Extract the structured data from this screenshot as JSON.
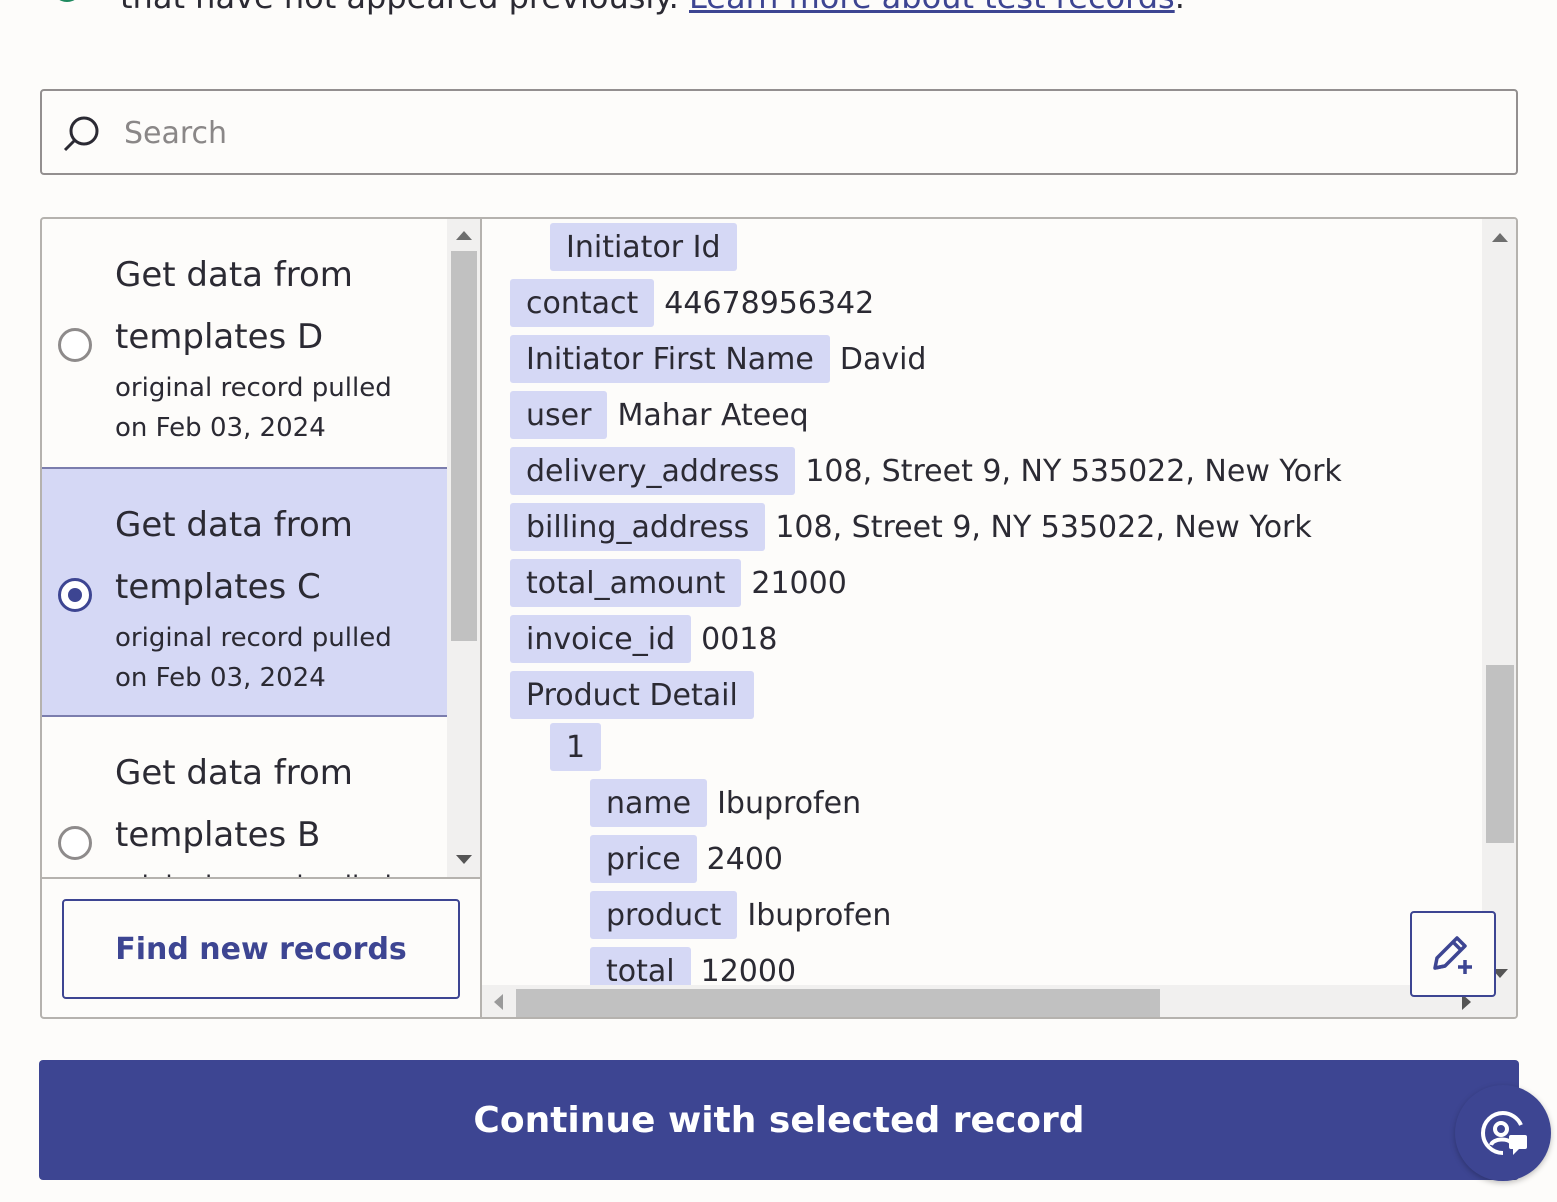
{
  "intro": {
    "text": "that have not appeared previously.",
    "link": "Learn more about test records",
    "trailing": "."
  },
  "search": {
    "placeholder": "Search"
  },
  "records": [
    {
      "title_line1": "Get data from",
      "title_line2": "templates D",
      "sub_line1": "original record pulled",
      "sub_line2": "on Feb 03, 2024",
      "selected": false
    },
    {
      "title_line1": "Get data from",
      "title_line2": "templates C",
      "sub_line1": "original record pulled",
      "sub_line2": "on Feb 03, 2024",
      "selected": true
    },
    {
      "title_line1": "Get data from",
      "title_line2": "templates B",
      "sub_line1": "original record pulled",
      "sub_line2": "",
      "selected": false
    }
  ],
  "find_button": "Find new records",
  "fields": [
    {
      "key": "Initiator Id",
      "value": ""
    },
    {
      "key": "contact",
      "value": "44678956342"
    },
    {
      "key": "Initiator First Name",
      "value": "David"
    },
    {
      "key": "user",
      "value": "Mahar Ateeq"
    },
    {
      "key": "delivery_address",
      "value": "108, Street 9,  NY 535022, New York"
    },
    {
      "key": "billing_address",
      "value": "108, Street 9,  NY 535022, New York"
    },
    {
      "key": "total_amount",
      "value": "21000"
    },
    {
      "key": "invoice_id",
      "value": "0018"
    },
    {
      "key": "Product Detail",
      "value": ""
    },
    {
      "key": "1",
      "value": ""
    },
    {
      "key": "name",
      "value": "Ibuprofen"
    },
    {
      "key": "price",
      "value": "2400"
    },
    {
      "key": "product",
      "value": "Ibuprofen"
    },
    {
      "key": "total",
      "value": "12000"
    }
  ],
  "continue_button": "Continue with selected record",
  "icons": {
    "search": "search-icon",
    "edit": "edit-add-icon",
    "help": "help-chat-icon"
  },
  "colors": {
    "accent": "#3d4592",
    "selected_bg": "#d5d8f5",
    "key_bg": "#d5d8f5"
  }
}
